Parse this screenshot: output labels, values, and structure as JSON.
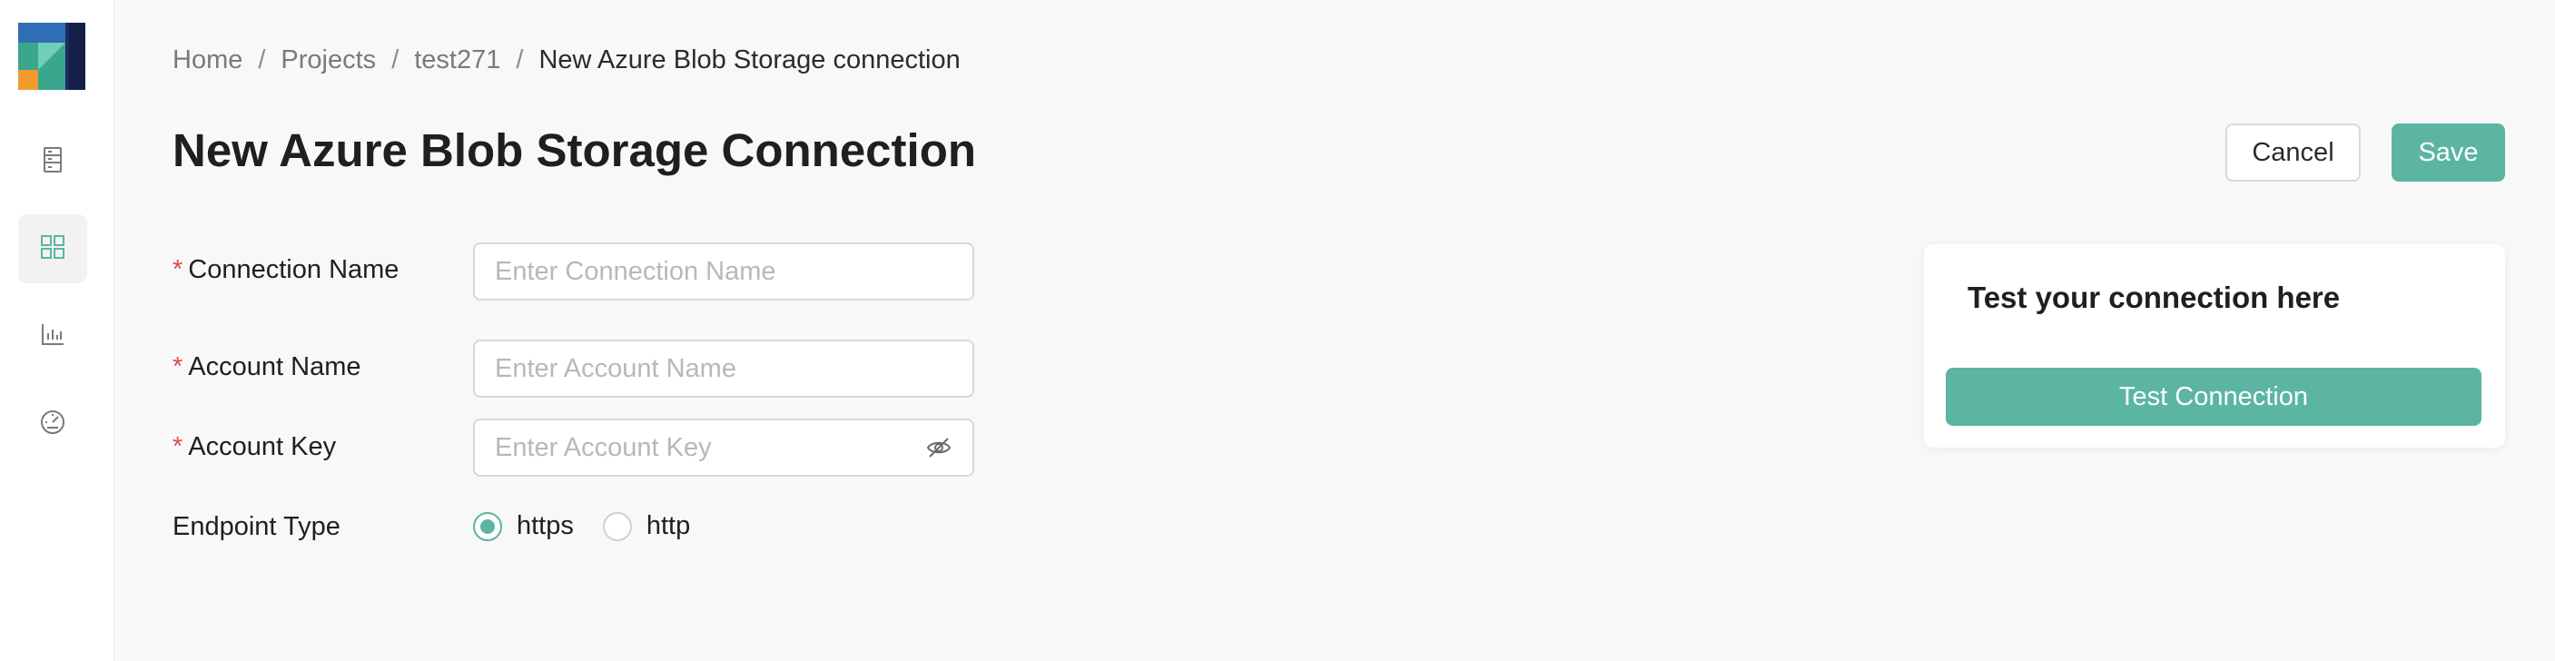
{
  "breadcrumb": {
    "items": [
      "Home",
      "Projects",
      "test271"
    ],
    "separator": "/",
    "current": "New Azure Blob Storage connection"
  },
  "page": {
    "title": "New Azure Blob Storage Connection"
  },
  "actions": {
    "cancel_label": "Cancel",
    "save_label": "Save"
  },
  "form": {
    "required_marker": "*",
    "connection_name": {
      "label": "Connection Name",
      "value": "",
      "placeholder": "Enter Connection Name"
    },
    "account_name": {
      "label": "Account Name",
      "value": "",
      "placeholder": "Enter Account Name"
    },
    "account_key": {
      "label": "Account Key",
      "value": "",
      "placeholder": "Enter Account Key"
    },
    "endpoint_type": {
      "label": "Endpoint Type",
      "options": [
        "https",
        "http"
      ],
      "selected": "https"
    }
  },
  "test_panel": {
    "title": "Test your connection here",
    "button_label": "Test Connection"
  },
  "sidebar": {
    "items": [
      {
        "icon": "server-icon",
        "active": false
      },
      {
        "icon": "grid-icon",
        "active": true
      },
      {
        "icon": "bar-chart-icon",
        "active": false
      },
      {
        "icon": "gauge-icon",
        "active": false
      }
    ]
  },
  "colors": {
    "accent": "#5bb5a2",
    "required": "#e5484d",
    "logo_navy": "#1f2b5c",
    "logo_teal": "#3aa68e",
    "logo_orange": "#f29a2e",
    "logo_blue": "#2f6db5"
  }
}
